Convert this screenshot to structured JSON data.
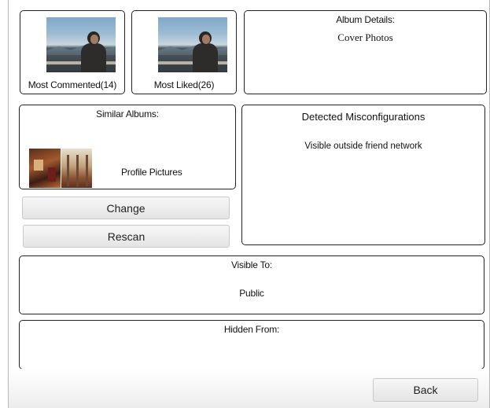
{
  "photos": {
    "most_commented_label": "Most Commented(14)",
    "most_liked_label": "Most Liked(26)"
  },
  "album_details": {
    "heading": "Album Details:",
    "name": "Cover Photos"
  },
  "similar_albums": {
    "heading": "Similar Albums:",
    "items": [
      {
        "label": "Profile Pictures"
      }
    ]
  },
  "misconfigurations": {
    "heading": "Detected Misconfigurations",
    "items": [
      "Visible outside friend network"
    ]
  },
  "buttons": {
    "change": "Change",
    "rescan": "Rescan",
    "back": "Back"
  },
  "visible_to": {
    "heading": "Visible To:",
    "value": "Public"
  },
  "hidden_from": {
    "heading": "Hidden From:",
    "value": ""
  }
}
